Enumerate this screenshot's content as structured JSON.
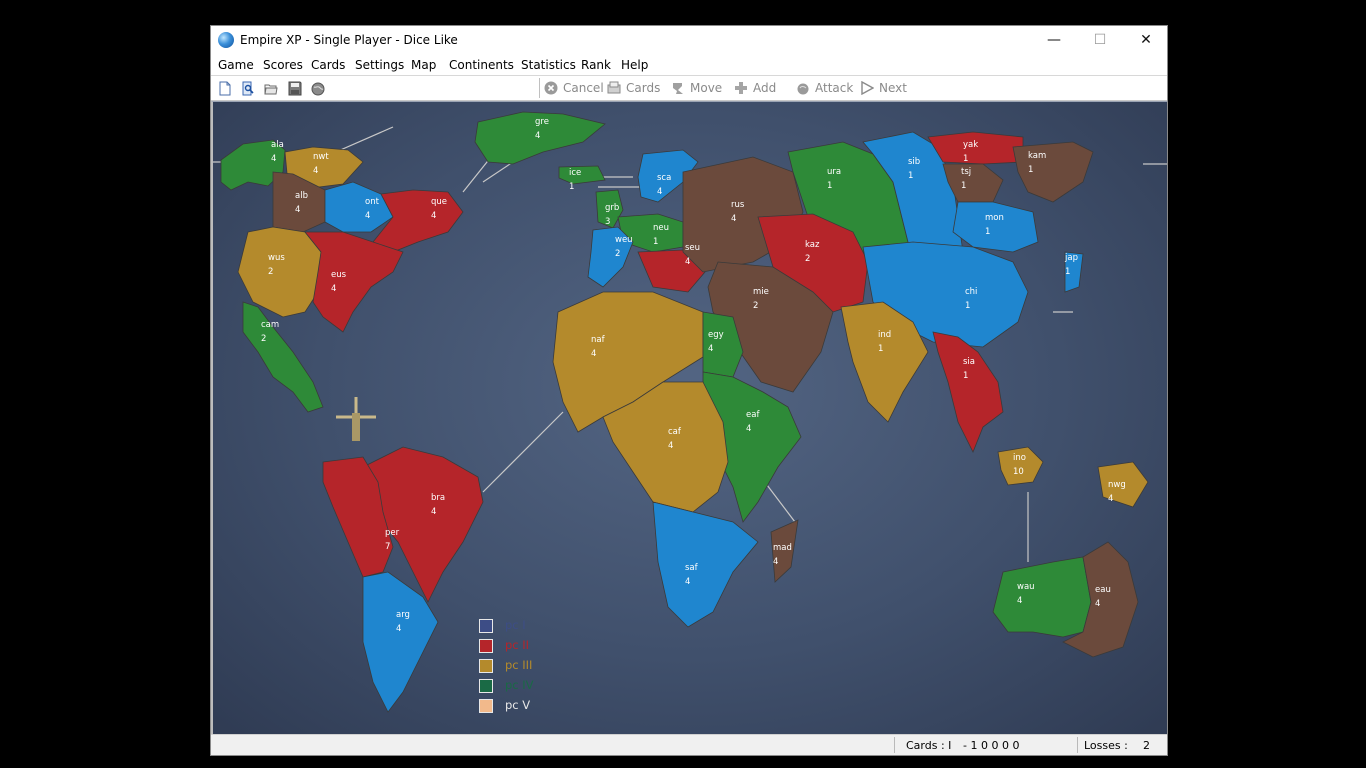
{
  "window": {
    "title": "Empire XP - Single Player - Dice Like",
    "minimize_glyph": "—",
    "maximize_glyph": "☐",
    "close_glyph": "✕"
  },
  "menu": [
    "Game",
    "Scores",
    "Cards",
    "Settings",
    "Map",
    "Continents",
    "Statistics",
    "Rank",
    "Help"
  ],
  "toolbar": {
    "file_icons": [
      "new-file-icon",
      "preview-icon",
      "open-folder-icon",
      "save-icon",
      "globe-icon"
    ],
    "cancel_label": "Cancel",
    "cards_label": "Cards",
    "move_label": "Move",
    "add_label": "Add",
    "attack_label": "Attack",
    "next_label": "Next"
  },
  "colors": {
    "player1": "#3d4d86",
    "player2": "#b5252a",
    "player3": "#b48a2c",
    "player4": "#2e8a38",
    "player5": "#f2b98b",
    "blue_territory": "#1f86cf",
    "brown_territory": "#6b4a3c",
    "orange_territory": "#d98a1c"
  },
  "territories": [
    {
      "code": "ala",
      "armies": "4"
    },
    {
      "code": "nwt",
      "armies": "4"
    },
    {
      "code": "gre",
      "armies": "4"
    },
    {
      "code": "alb",
      "armies": "4"
    },
    {
      "code": "ont",
      "armies": "4"
    },
    {
      "code": "que",
      "armies": "4"
    },
    {
      "code": "wus",
      "armies": "2"
    },
    {
      "code": "eus",
      "armies": "4"
    },
    {
      "code": "cam",
      "armies": "2"
    },
    {
      "code": "ice",
      "armies": "1"
    },
    {
      "code": "sca",
      "armies": "4"
    },
    {
      "code": "grb",
      "armies": "3"
    },
    {
      "code": "neu",
      "armies": "1"
    },
    {
      "code": "weu",
      "armies": "2"
    },
    {
      "code": "seu",
      "armies": "4"
    },
    {
      "code": "rus",
      "armies": "4"
    },
    {
      "code": "ura",
      "armies": "1"
    },
    {
      "code": "sib",
      "armies": "1"
    },
    {
      "code": "yak",
      "armies": "1"
    },
    {
      "code": "kam",
      "armies": "1"
    },
    {
      "code": "tsj",
      "armies": "1"
    },
    {
      "code": "mon",
      "armies": "1"
    },
    {
      "code": "jap",
      "armies": "1"
    },
    {
      "code": "kaz",
      "armies": "2"
    },
    {
      "code": "chi",
      "armies": "1"
    },
    {
      "code": "mie",
      "armies": "2"
    },
    {
      "code": "ind",
      "armies": "1"
    },
    {
      "code": "sia",
      "armies": "1"
    },
    {
      "code": "naf",
      "armies": "4"
    },
    {
      "code": "egy",
      "armies": "4"
    },
    {
      "code": "eaf",
      "armies": "4"
    },
    {
      "code": "caf",
      "armies": "4"
    },
    {
      "code": "saf",
      "armies": "4"
    },
    {
      "code": "mad",
      "armies": "4"
    },
    {
      "code": "bra",
      "armies": "4"
    },
    {
      "code": "per",
      "armies": "7"
    },
    {
      "code": "arg",
      "armies": "4"
    },
    {
      "code": "ino",
      "armies": "10"
    },
    {
      "code": "nwg",
      "armies": "4"
    },
    {
      "code": "wau",
      "armies": "4"
    },
    {
      "code": "eau",
      "armies": "4"
    }
  ],
  "legend": [
    {
      "label": "pc I",
      "color": "#3d4d86",
      "text_color": "#3d4d86"
    },
    {
      "label": "pc II",
      "color": "#b5252a",
      "text_color": "#b5252a"
    },
    {
      "label": "pc III",
      "color": "#b48a2c",
      "text_color": "#b48a2c"
    },
    {
      "label": "pc IV",
      "color": "#1a6a45",
      "text_color": "#1a6a45"
    },
    {
      "label": "pc V",
      "color": "#f2b98b",
      "text_color": "#e8e8e8"
    }
  ],
  "status": {
    "cards_label": "Cards : I",
    "cards_value": "- 1 0 0 0 0",
    "losses_label": "Losses :",
    "losses_value": "2"
  }
}
